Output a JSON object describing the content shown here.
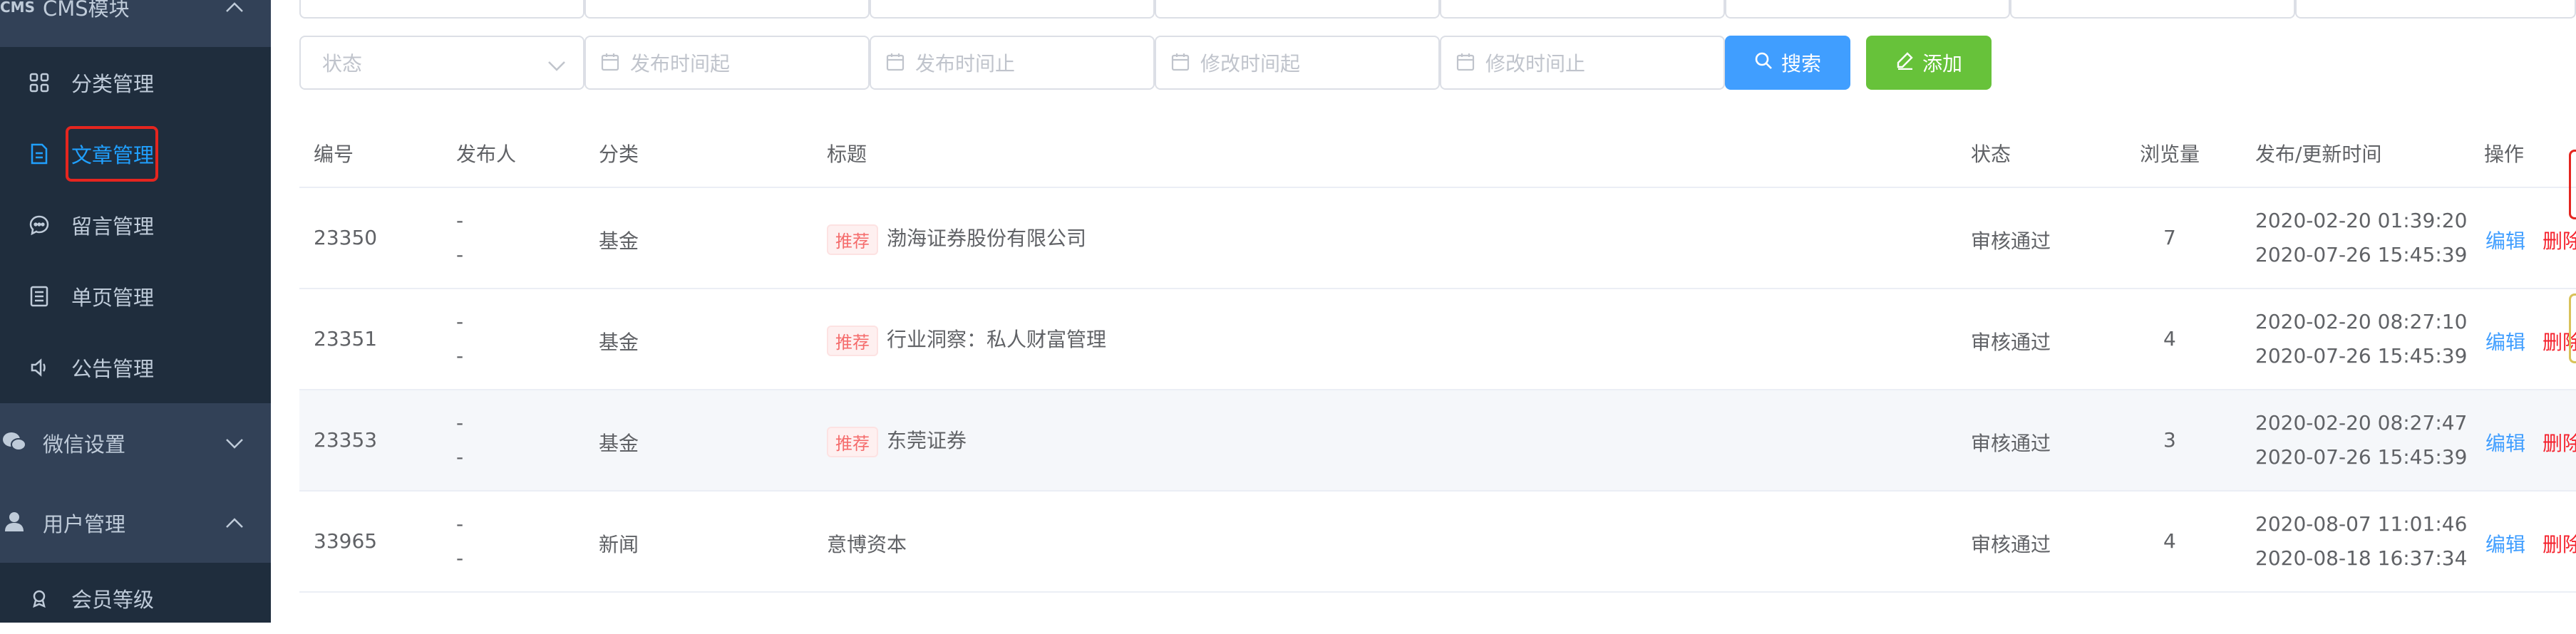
{
  "sidebar": {
    "cms_group": {
      "label": "CMS模块",
      "icon": "cms-icon"
    },
    "cms_items": [
      {
        "label": "分类管理",
        "icon": "grid-icon"
      },
      {
        "label": "文章管理",
        "icon": "document-icon",
        "active": true
      },
      {
        "label": "留言管理",
        "icon": "message-icon"
      },
      {
        "label": "单页管理",
        "icon": "page-icon"
      },
      {
        "label": "公告管理",
        "icon": "speaker-icon"
      }
    ],
    "wechat_group": {
      "label": "微信设置",
      "icon": "wechat-icon"
    },
    "user_group": {
      "label": "用户管理",
      "icon": "user-icon"
    },
    "user_items": [
      {
        "label": "会员等级",
        "icon": "level-icon"
      }
    ]
  },
  "filters": {
    "status_placeholder": "状态",
    "publish_start_placeholder": "发布时间起",
    "publish_end_placeholder": "发布时间止",
    "modify_start_placeholder": "修改时间起",
    "modify_end_placeholder": "修改时间止",
    "search_label": "搜索",
    "add_label": "添加"
  },
  "table": {
    "columns": [
      "编号",
      "发布人",
      "分类",
      "标题",
      "状态",
      "浏览量",
      "发布/更新时间",
      "操作"
    ],
    "recommend_tag": "推荐",
    "edit_label": "编辑",
    "delete_label": "删除",
    "rows": [
      {
        "id": "23350",
        "publisher": "-",
        "publisher2": "-",
        "category": "基金",
        "recommended": true,
        "title": "渤海证券股份有限公司",
        "status": "审核通过",
        "views": "7",
        "published": "2020-02-20 01:39:20",
        "updated": "2020-07-26 15:45:39"
      },
      {
        "id": "23351",
        "publisher": "-",
        "publisher2": "-",
        "category": "基金",
        "recommended": true,
        "title": "行业洞察：私人财富管理",
        "status": "审核通过",
        "views": "4",
        "published": "2020-02-20 08:27:10",
        "updated": "2020-07-26 15:45:39"
      },
      {
        "id": "23353",
        "publisher": "-",
        "publisher2": "-",
        "category": "基金",
        "recommended": true,
        "title": "东莞证券",
        "status": "审核通过",
        "views": "3",
        "published": "2020-02-20 08:27:47",
        "updated": "2020-07-26 15:45:39"
      },
      {
        "id": "33965",
        "publisher": "-",
        "publisher2": "-",
        "category": "新闻",
        "recommended": false,
        "title": "意博资本",
        "status": "审核通过",
        "views": "4",
        "published": "2020-08-07 11:01:46",
        "updated": "2020-08-18 16:37:34"
      }
    ]
  },
  "colors": {
    "sidebar": "#324157",
    "submenu": "#1f2d3d",
    "active": "#20a0ff",
    "primary": "#409eff",
    "success": "#67c23a",
    "danger": "#f5222d",
    "highlight_border": "#e5251f"
  }
}
